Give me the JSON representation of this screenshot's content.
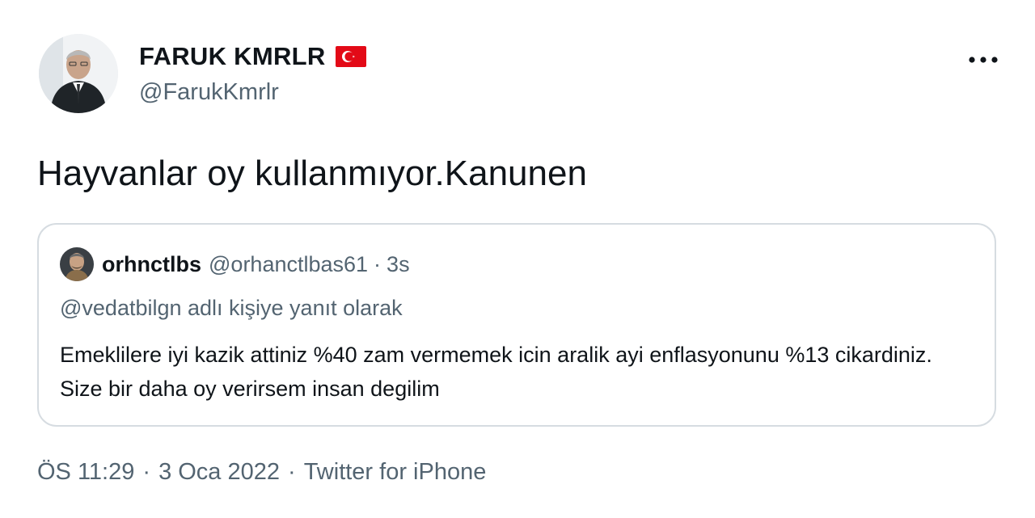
{
  "author": {
    "display_name": "FARUK KMRLR",
    "handle": "@FarukKmrlr",
    "avatar_icon": "profile-photo",
    "flag_icon": "turkey-flag-icon",
    "flag_color": "#e30a17"
  },
  "tweet": {
    "text": "Hayvanlar oy kullanmıyor.Kanunen"
  },
  "more_icon": "ellipsis-icon",
  "quoted_tweet": {
    "display_name": "orhnctlbs",
    "handle": "@orhanctlbas61",
    "separator": "·",
    "time": "3s",
    "reply_context": "@vedatbilgn adlı kişiye yanıt olarak",
    "text": "Emeklilere iyi kazik attiniz %40 zam vermemek icin aralik ayi enflasyonunu %13 cikardiniz. Size bir daha oy verirsem insan degilim"
  },
  "meta": {
    "time": "ÖS 11:29",
    "separator": "·",
    "date": "3 Oca 2022",
    "source": "Twitter for iPhone"
  },
  "colors": {
    "text_primary": "#0f1419",
    "text_secondary": "#536471",
    "border": "#d6dce1"
  }
}
